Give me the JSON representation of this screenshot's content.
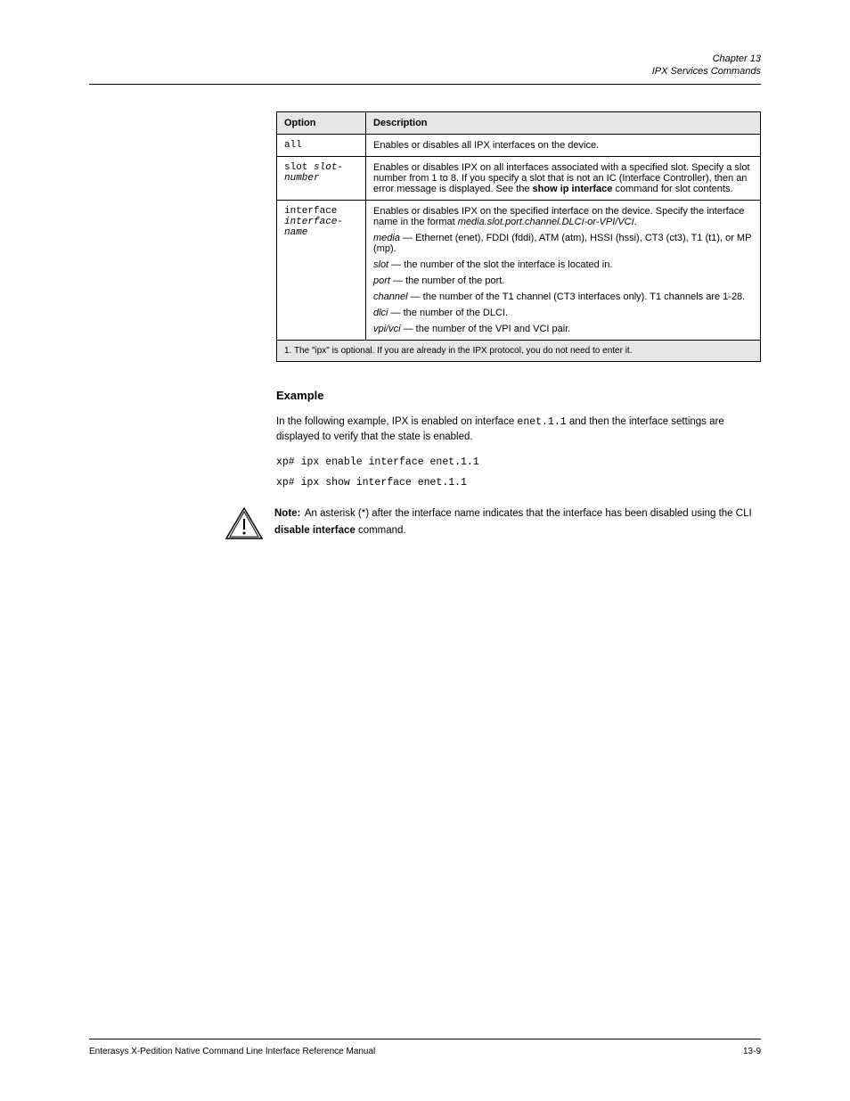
{
  "header": {
    "chapter_label": "Chapter 13",
    "chapter_title": "IPX Services Commands"
  },
  "table": {
    "col1_header": "Option",
    "col2_header": "Description",
    "rows": [
      {
        "option": "all",
        "desc_plain": "Enables or disables all IPX interfaces on the device."
      },
      {
        "option_html": "slot <span class='italic'>slot-number</span>",
        "desc_html": "Enables or disables IPX on all interfaces associated with a specified slot. Specify a slot number from 1 to 8. If you specify a slot that is not an IC (Interface Controller), then an error message is displayed. See the <span class='bold'>show ip interface</span> command for slot contents."
      },
      {
        "option_html": "interface <span class='italic'>interface-name</span>",
        "desc_html": "<p>Enables or disables IPX on the specified interface on the device. Specify the interface name in the format <span class='italic'>media.slot.port.channel.DLCI-or-VPI/VCI</span>.</p><p><span class='italic'>media</span> — Ethernet (enet), FDDI (fddi), ATM (atm), HSSI (hssi), CT3 (ct3), T1 (t1), or MP (mp).</p><p><span class='italic'>slot</span> — the number of the slot the interface is located in.</p><p><span class='italic'>port</span> — the number of the port.</p><p><span class='italic'>channel</span> — the number of the T1 channel (CT3 interfaces only). T1 channels are 1-28.</p><p><span class='italic'>dlci</span> — the number of the DLCI.</p><p><span class='italic'>vpi/vci</span> — the number of the VPI and VCI pair.</p>"
      }
    ],
    "footer_html": "1. The &quot;ipx&quot; is optional. If you are already in the IPX protocol, you do not need to enter it."
  },
  "section": {
    "title": "Example",
    "para1_html": "In the following example, IPX is enabled on interface <span class='mono'>enet.1.1</span> and then the interface settings are displayed to verify that the state is enabled.",
    "cmd1": "xp# ipx enable interface enet.1.1",
    "cmd2": "xp# ipx show interface enet.1.1",
    "note_label": "Note:",
    "note_text_html": "An asterisk (*) after the interface name indicates that the interface has been disabled using the CLI <span class='bold'>disable interface</span> command."
  },
  "footer": {
    "left": "Enterasys X-Pedition Native Command Line Interface Reference Manual",
    "right": "13-9"
  }
}
